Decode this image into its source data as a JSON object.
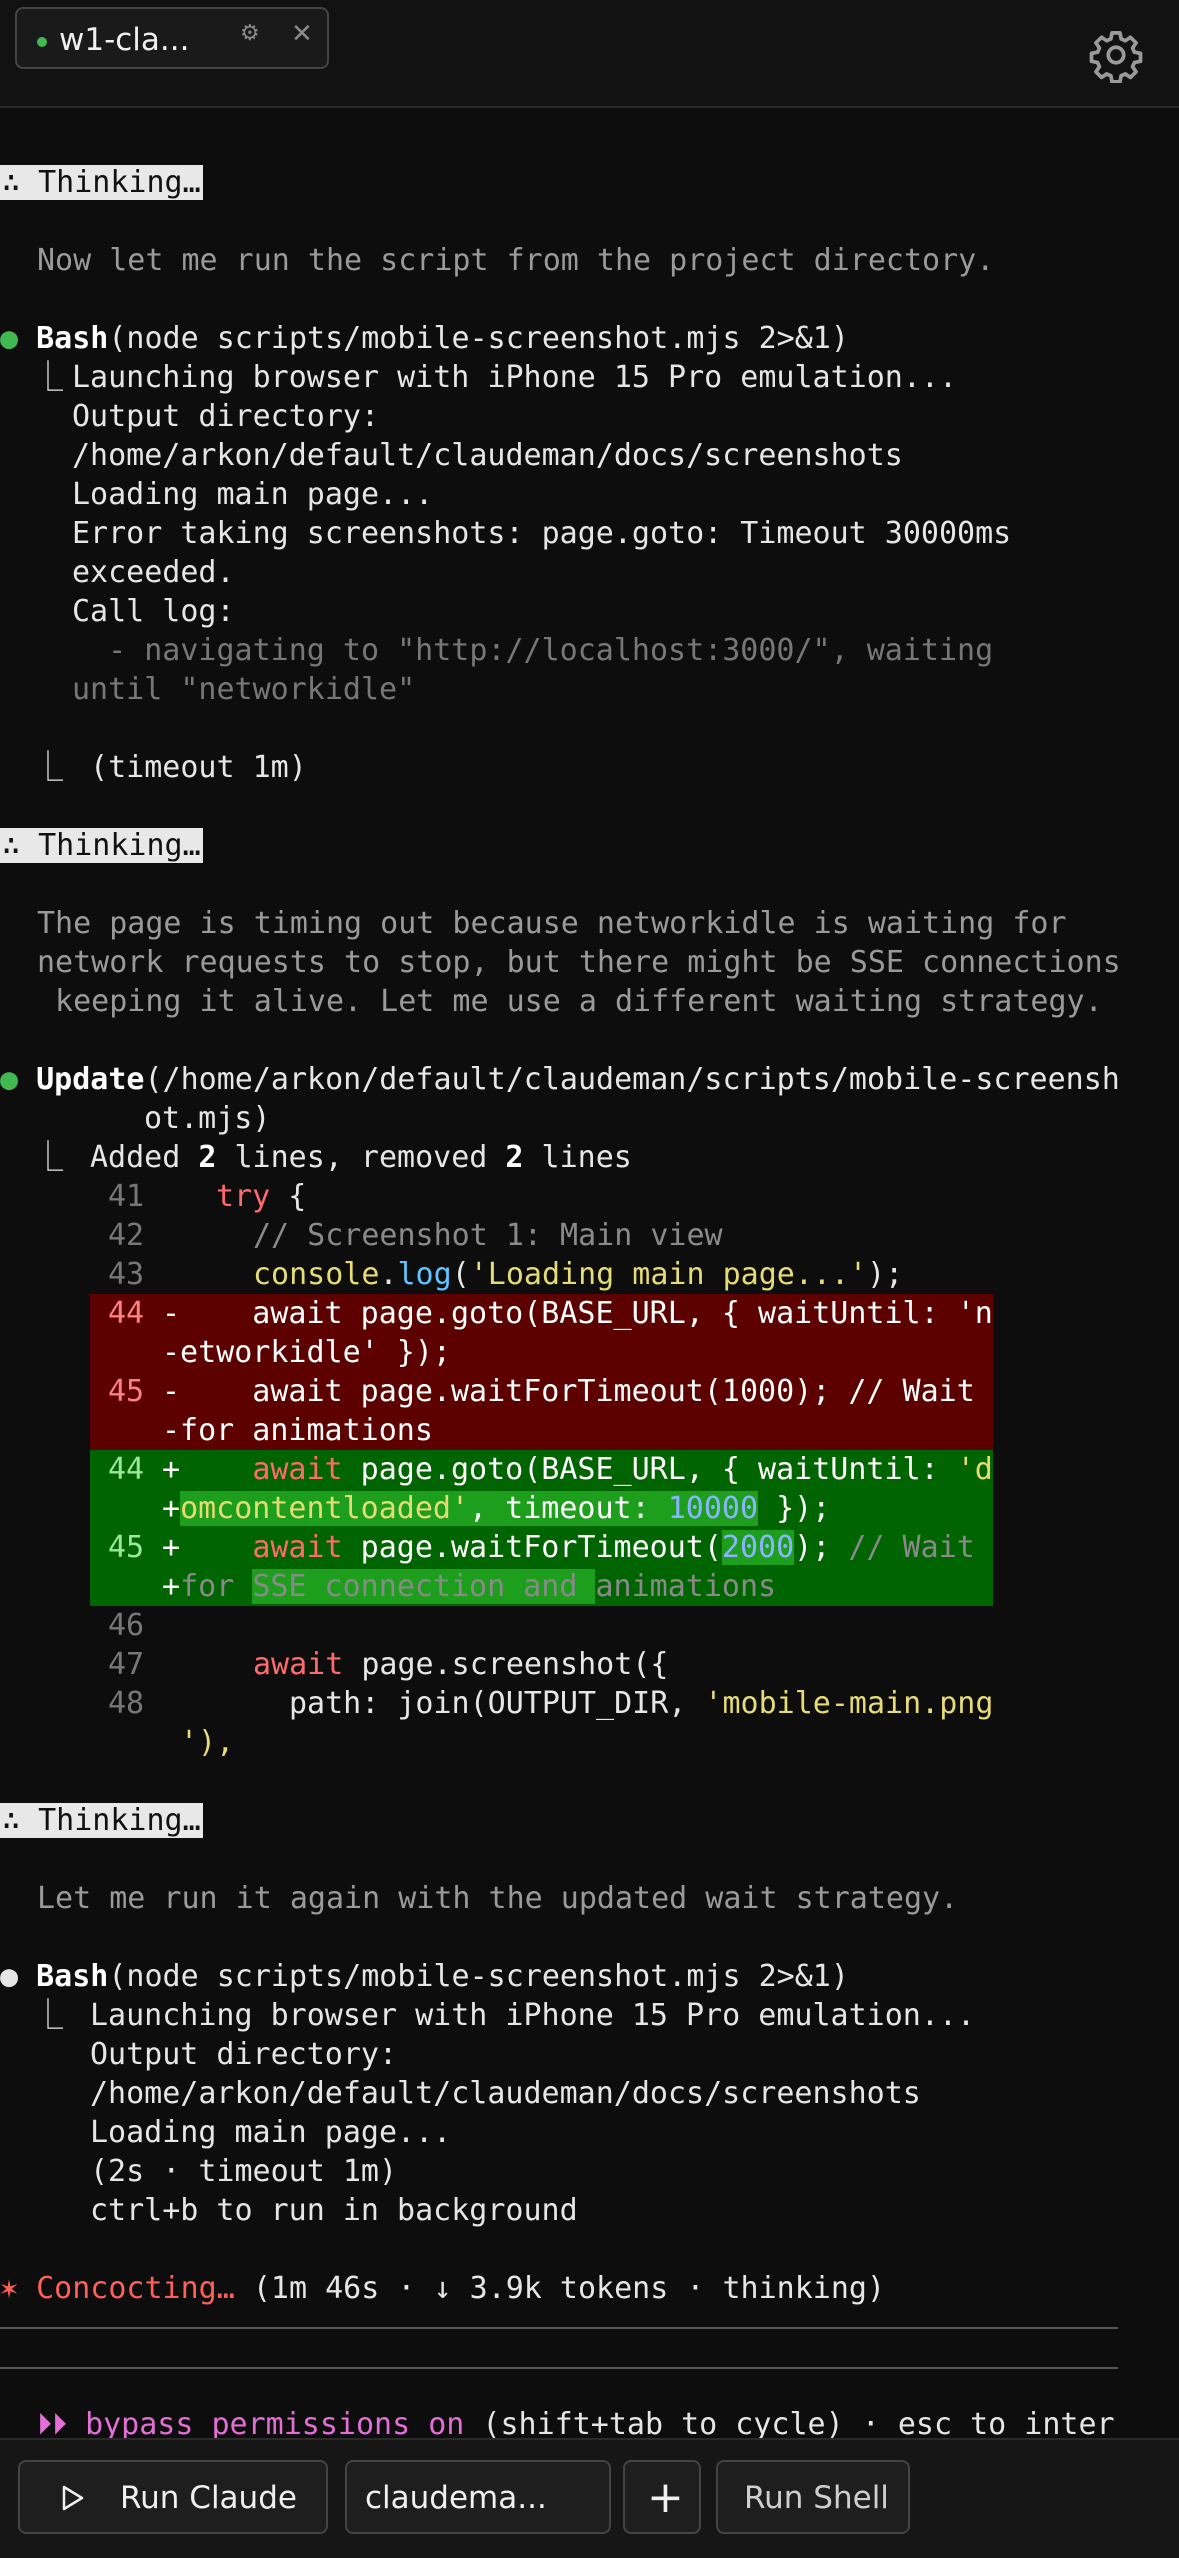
{
  "header": {
    "tab_label": "w1-cla...",
    "tab_gear_icon": "⚙",
    "tab_close_icon": "✕"
  },
  "terminal": {
    "thinking_label": "∴ Thinking…",
    "msg1": "Now let me run the script from the project directory.",
    "bash1": {
      "tool": "Bash",
      "args": "(node scripts/mobile-screenshot.mjs 2>&1)",
      "output": [
        "Launching browser with iPhone 15 Pro emulation...",
        "Output directory:",
        "/home/arkon/default/claudeman/docs/screenshots",
        "Loading main page...",
        "Error taking screenshots: page.goto: Timeout 30000ms",
        "exceeded.",
        "Call log:",
        "  - navigating to \"http://localhost:3000/\", waiting",
        "until \"networkidle\""
      ],
      "timeout": " (timeout 1m)"
    },
    "msg2": [
      "The page is timing out because networkidle is waiting for",
      "network requests to stop, but there might be SSE connections",
      " keeping it alive. Let me use a different waiting strategy."
    ],
    "update": {
      "tool": "Update",
      "path_line1": "(/home/arkon/default/claudeman/scripts/mobile-screensh",
      "path_line2": "ot.mjs)",
      "summary_pre": "Added ",
      "added": "2",
      "summary_mid": " lines, removed ",
      "removed": "2",
      "summary_post": " lines"
    },
    "diff": {
      "ln41": "41",
      "ln42": "42",
      "ln43": "43",
      "ln44": "44",
      "ln45": "45",
      "ln46": "46",
      "ln47": "47",
      "ln48": "48",
      "c41_kw": "try",
      "c41_rest": " {",
      "c42": "// Screenshot 1: Main view",
      "c43_a": "console",
      "c43_b": ".",
      "c43_c": "log",
      "c43_d": "(",
      "c43_e": "'Loading main page...'",
      "c43_f": ");",
      "del44_a": "-    await page.goto(BASE_URL, { waitUntil: 'n",
      "del44_b": "-etworkidle' });",
      "del45_a": "-    await page.waitForTimeout(1000); // Wait",
      "del45_b": "-for animations",
      "add44_pre": "+    ",
      "add44_kw": "await",
      "add44_mid": " page.goto(BASE_URL, { waitUntil: ",
      "add44_str": "'d",
      "add44b_pre": "+",
      "add44b_str": "omcontentloaded'",
      "add44b_mid": ", timeout: ",
      "add44b_num": "10000",
      "add44b_post": " });",
      "add45_pre": "+    ",
      "add45_kw": "await",
      "add45_mid": " page.waitForTimeout(",
      "add45_num": "2000",
      "add45_post": "); ",
      "add45_cm": "// Wait",
      "add45b_pre": "+",
      "add45b_cm1": "for ",
      "add45b_cm2": "SSE connection and ",
      "add45b_cm3": "animations",
      "c47_kw": "await",
      "c47_rest": " page.screenshot({",
      "c48_a": "path: join(OUTPUT_DIR, ",
      "c48_str": "'mobile-main.png",
      "c48_cont": "'),"
    },
    "msg3": "Let me run it again with the updated wait strategy.",
    "bash2": {
      "tool": "Bash",
      "args": "(node scripts/mobile-screenshot.mjs 2>&1)",
      "output": [
        "Launching browser with iPhone 15 Pro emulation...",
        "Output directory:",
        "/home/arkon/default/claudeman/docs/screenshots",
        "Loading main page...",
        "(2s · timeout 1m)",
        "ctrl+b to run in background"
      ]
    },
    "status": {
      "star": "✶",
      "word": "Concocting…",
      "detail": " (1m 46s · ↓ 3.9k tokens · thinking)"
    },
    "permissions": {
      "icon": "⏵⏵",
      "label": "bypass permissions on",
      "hint": " (shift+tab to cycle) · esc to inter"
    },
    "glyph_box": "⎿"
  },
  "toolbar": {
    "run_claude_label": "Run Claude",
    "session_label": "claudema...",
    "add_label": "+",
    "run_shell_label": "Run Shell"
  },
  "colors": {
    "background": "#0d0d0d",
    "diff_removed": "#5c0000",
    "diff_added": "#006400",
    "accent_green": "#3fb950",
    "status_red": "#ff5f57",
    "permissions_pink": "#e36fd6"
  }
}
